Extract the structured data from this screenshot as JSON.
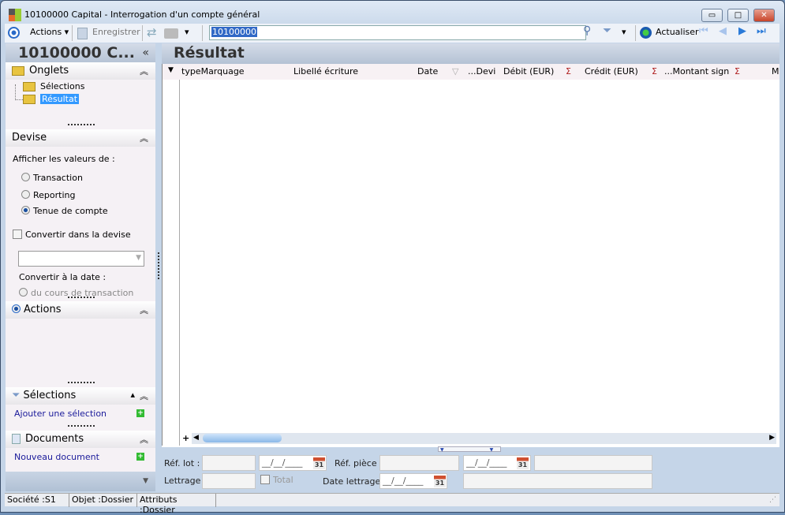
{
  "window": {
    "title": "10100000 Capital -  Interrogation d'un compte général",
    "minimize": "▭",
    "maximize": "□",
    "close": "✕"
  },
  "toolbar": {
    "actions": "Actions",
    "save": "Enregistrer",
    "search_value": "10100000",
    "refresh": "Actualiser"
  },
  "sidebar": {
    "title": "10100000 C...",
    "collapse": "«",
    "onglets": {
      "title": "Onglets",
      "items": [
        "Sélections",
        "Résultat"
      ]
    },
    "devise": {
      "title": "Devise",
      "prompt": "Afficher les valeurs de :",
      "options": [
        "Transaction",
        "Reporting",
        "Tenue de compte"
      ],
      "selected": "Tenue de compte",
      "convert_label": "Convertir dans la devise",
      "convert_date_label": "Convertir à la date :",
      "rate_option": "du cours de transaction"
    },
    "actions": {
      "title": "Actions"
    },
    "selections": {
      "title": "Sélections",
      "add": "Ajouter une sélection"
    },
    "documents": {
      "title": "Documents",
      "add": "Nouveau document"
    }
  },
  "main": {
    "title": "Résultat",
    "columns": [
      "typeMarquage",
      "Libellé écriture",
      "Date",
      "...Devi",
      "Débit (EUR)",
      "Crédit (EUR)",
      "...Montant sign",
      "M"
    ],
    "sigma": "Σ"
  },
  "filters": {
    "ref_lot": "Réf. lot :",
    "ref_piece": "Réf. pièce :",
    "lettrage": "Lettrage :",
    "total": "Total",
    "date_lettrage": "Date lettrage :",
    "date_mask": "__/__/____",
    "cal": "31"
  },
  "status": {
    "societe": "Société :S1",
    "objet": "Objet :Dossier",
    "attributs": "Attributs :Dossier"
  }
}
